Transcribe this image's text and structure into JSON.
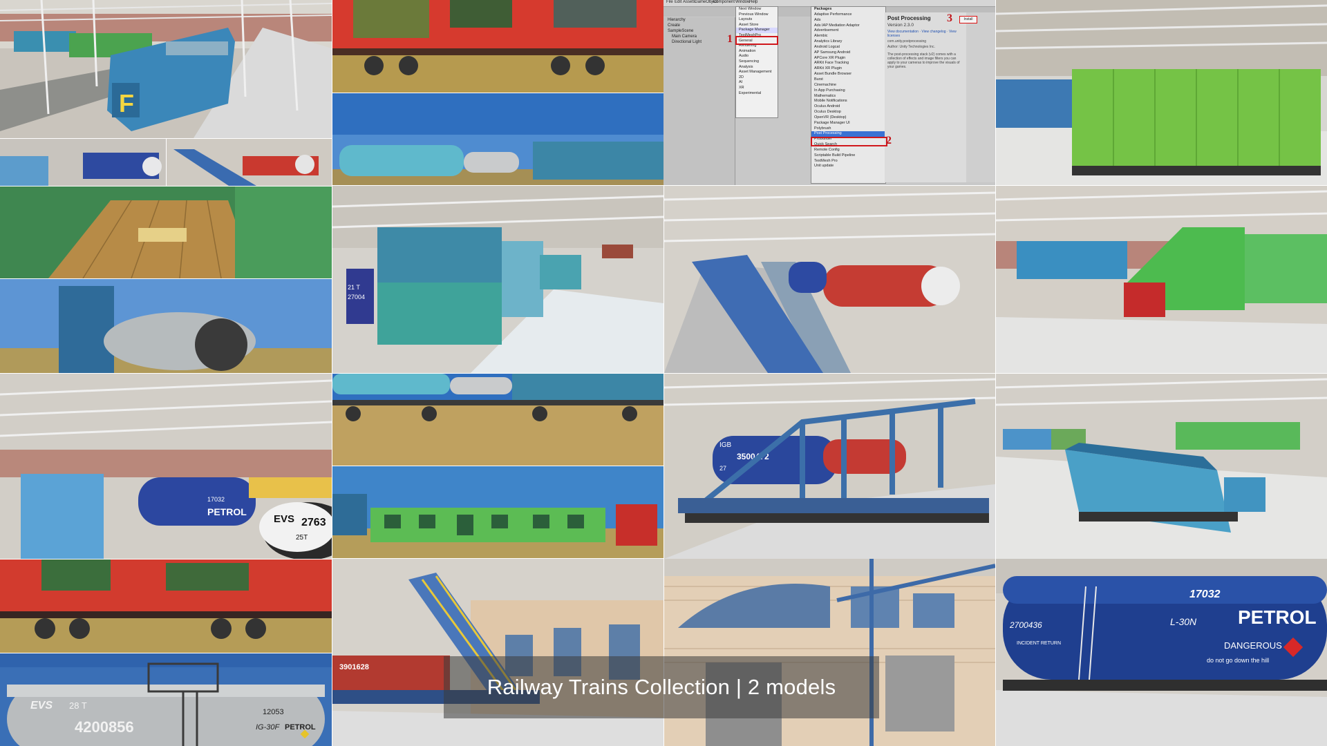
{
  "caption": "Railway Trains Collection | 2 models",
  "tank_labels": {
    "evs": "EVS",
    "capacity": "28 T",
    "car_number": "4200856",
    "series": "12053",
    "type_code": "IG-30F",
    "product": "PETROL"
  },
  "petrol_tank": {
    "number_top": "17032",
    "number_side": "2700436",
    "type": "L-30N",
    "product": "PETROL",
    "warning": "DANGEROUS",
    "notice": "do not go down the hill",
    "return": "INCIDENT RETURN"
  },
  "flat_car_labels": {
    "tank_number": "3500472",
    "tank_prefix": "IGB",
    "tank_sub": "27",
    "red_car_number": "3901628"
  },
  "evs_tank_small": {
    "label": "EVS",
    "number": "2763",
    "capacity": "25T"
  },
  "tank_inner": {
    "num": "27004",
    "cap": "21 T"
  },
  "petrol_small": {
    "product": "PETROL",
    "number": "17032"
  },
  "locomotive_letter": "F",
  "editor": {
    "menu": [
      "File",
      "Edit",
      "Assets",
      "GameObject",
      "Component",
      "Window",
      "Help"
    ],
    "hierarchy_items": [
      "Hierarchy",
      "Create",
      "SampleScene",
      "Main Camera",
      "Directional Light"
    ],
    "window_menu": [
      "Next Window",
      "Previous Window",
      "",
      "Layouts",
      "",
      "Asset Store",
      "Package Manager",
      "TextMeshPro",
      "",
      "General",
      "Rendering",
      "Animation",
      "Audio",
      "Sequencing",
      "Analysis",
      "Asset Management",
      "2D",
      "AI",
      "XR",
      "",
      "Experimental"
    ],
    "packages_header": "Packages",
    "packages": [
      "Adaptive Performance",
      "Ads",
      "Ads IAP Mediation Adaptor",
      "Advertisement",
      "Alembic",
      "Analytics Library",
      "Android Logcat",
      "AP Samsung Android",
      "APCore XR Plugin",
      "ARKit Face Tracking",
      "ARKit XR Plugin",
      "Asset Bundle Browser",
      "Burst",
      "Cinemachine",
      "In App Purchasing",
      "Mathematics",
      "Mobile Notifications",
      "Oculus Android",
      "Oculus Desktop",
      "OpenVR (Desktop)",
      "Package Manager UI",
      "Polybrush",
      "Post Processing",
      "ProBuilder",
      "Quick Search",
      "Remote Config",
      "Scriptable Build Pipeline",
      "TextMesh Pro",
      "Unit update"
    ],
    "selected_package": "Post Processing",
    "detail_title": "Post Processing",
    "detail_version": "Version 2.3.0",
    "detail_id": "com.unity.postprocessing",
    "detail_author": "Author: Unity Technologies Inc.",
    "detail_desc": "The post-processing stack (v2) comes with a collection of effects and image filters you can apply to your cameras to improve the visuals of your games.",
    "detail_links": "View documentation · View changelog · View licenses",
    "install_label": "Install",
    "step_labels": [
      "1",
      "2",
      "3"
    ]
  },
  "colors": {
    "caption_bg": "#3c3c3c",
    "accent_red": "#d0161b",
    "tank_blue": "#1f3f8f",
    "loco_blue": "#3b87b9",
    "loco_green": "#4caf4a"
  }
}
